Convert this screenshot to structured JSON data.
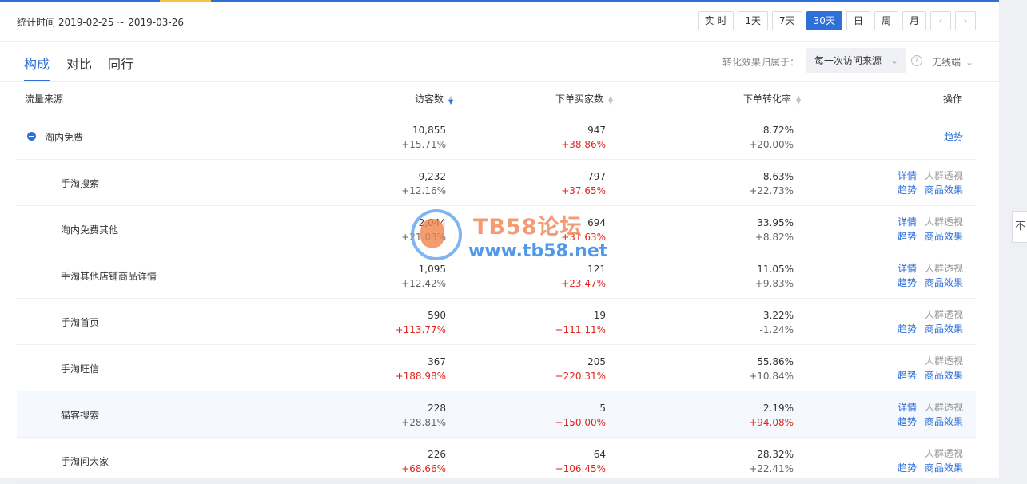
{
  "header": {
    "stat_label": "统计时间 2019-02-25 ~ 2019-03-26",
    "ranges": [
      "实 时",
      "1天",
      "7天",
      "30天",
      "日",
      "周",
      "月"
    ],
    "active_range": "30天",
    "prev_icon": "‹",
    "next_icon": "›"
  },
  "tabs": {
    "items": [
      "构成",
      "对比",
      "同行"
    ],
    "active": "构成",
    "attr_label": "转化效果归属于：",
    "attr_value": "每一次访问来源",
    "help_icon": "?",
    "device": "无线端"
  },
  "table": {
    "headers": {
      "source": "流量来源",
      "visitors": "访客数",
      "buyers": "下单买家数",
      "rate": "下单转化率",
      "ops": "操作"
    },
    "sorted_column": "visitors",
    "rows": [
      {
        "source": "淘内免费",
        "visitors": "10,855",
        "visitors_change": "+15.71%",
        "buyers": "947",
        "buyers_change": "+38.86%",
        "rate": "8.72%",
        "rate_change": "+20.00%",
        "ops": {
          "trend": "趋势"
        }
      },
      {
        "source": "手淘搜索",
        "visitors": "9,232",
        "visitors_change": "+12.16%",
        "buyers": "797",
        "buyers_change": "+37.65%",
        "rate": "8.63%",
        "rate_change": "+22.73%",
        "ops": {
          "detail": "详情",
          "crowd": "人群透视",
          "trend": "趋势",
          "goods": "商品效果"
        }
      },
      {
        "source": "淘内免费其他",
        "visitors": "2,044",
        "visitors_change": "+21.03%",
        "buyers": "694",
        "buyers_change": "+31.63%",
        "rate": "33.95%",
        "rate_change": "+8.82%",
        "ops": {
          "detail": "详情",
          "crowd": "人群透视",
          "trend": "趋势",
          "goods": "商品效果"
        }
      },
      {
        "source": "手淘其他店铺商品详情",
        "visitors": "1,095",
        "visitors_change": "+12.42%",
        "buyers": "121",
        "buyers_change": "+23.47%",
        "rate": "11.05%",
        "rate_change": "+9.83%",
        "ops": {
          "detail": "详情",
          "crowd": "人群透视",
          "trend": "趋势",
          "goods": "商品效果"
        }
      },
      {
        "source": "手淘首页",
        "visitors": "590",
        "visitors_change": "+113.77%",
        "buyers": "19",
        "buyers_change": "+111.11%",
        "rate": "3.22%",
        "rate_change": "-1.24%",
        "ops": {
          "crowd": "人群透视",
          "trend": "趋势",
          "goods": "商品效果"
        }
      },
      {
        "source": "手淘旺信",
        "visitors": "367",
        "visitors_change": "+188.98%",
        "buyers": "205",
        "buyers_change": "+220.31%",
        "rate": "55.86%",
        "rate_change": "+10.84%",
        "ops": {
          "crowd": "人群透视",
          "trend": "趋势",
          "goods": "商品效果"
        }
      },
      {
        "source": "猫客搜索",
        "visitors": "228",
        "visitors_change": "+28.81%",
        "buyers": "5",
        "buyers_change": "+150.00%",
        "rate": "2.19%",
        "rate_change": "+94.08%",
        "ops": {
          "detail": "详情",
          "crowd": "人群透视",
          "trend": "趋势",
          "goods": "商品效果"
        }
      },
      {
        "source": "手淘问大家",
        "visitors": "226",
        "visitors_change": "+68.66%",
        "buyers": "64",
        "buyers_change": "+106.45%",
        "rate": "28.32%",
        "rate_change": "+22.41%",
        "ops": {
          "crowd": "人群透视",
          "trend": "趋势",
          "goods": "商品效果"
        }
      }
    ]
  },
  "side_tab": "不",
  "watermark": {
    "title": "TB58论坛",
    "url": "www.tb58.net"
  },
  "colors": {
    "accent": "#2f6fd8",
    "red": "#e0251d",
    "gray": "#999999"
  }
}
